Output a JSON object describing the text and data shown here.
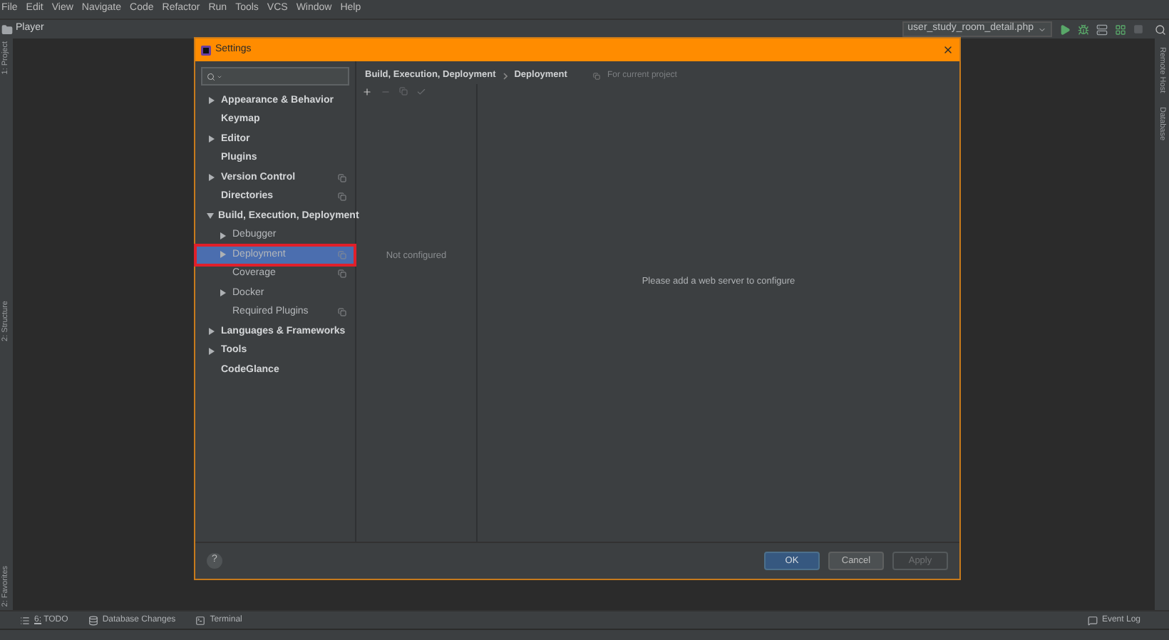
{
  "menu": [
    "File",
    "Edit",
    "View",
    "Navigate",
    "Code",
    "Refactor",
    "Run",
    "Tools",
    "VCS",
    "Window",
    "Help"
  ],
  "nav_bar": {
    "project": "Player",
    "run_config": "user_study_room_detail.php"
  },
  "left_strip": [
    "1: Project",
    "2: Structure",
    "2: Favorites"
  ],
  "right_strip": [
    "Remote Host",
    "Database"
  ],
  "dialog": {
    "title": "Settings",
    "tree": [
      {
        "label": "Appearance & Behavior",
        "kind": "group",
        "expanded": false,
        "selected": false,
        "highlighted": false,
        "project_scope": false
      },
      {
        "label": "Keymap",
        "kind": "leaf",
        "selected": false,
        "highlighted": false,
        "project_scope": false
      },
      {
        "label": "Editor",
        "kind": "group",
        "expanded": false,
        "selected": false,
        "highlighted": false,
        "project_scope": false
      },
      {
        "label": "Plugins",
        "kind": "leaf",
        "selected": false,
        "highlighted": false,
        "project_scope": false
      },
      {
        "label": "Version Control",
        "kind": "group",
        "expanded": false,
        "selected": false,
        "highlighted": false,
        "project_scope": true
      },
      {
        "label": "Directories",
        "kind": "leaf",
        "selected": false,
        "highlighted": false,
        "project_scope": true
      },
      {
        "label": "Build, Execution, Deployment",
        "kind": "group",
        "expanded": true,
        "selected": false,
        "highlighted": false,
        "project_scope": false,
        "children": [
          {
            "label": "Debugger",
            "kind": "group",
            "expanded": false,
            "selected": false,
            "highlighted": false,
            "project_scope": false
          },
          {
            "label": "Deployment",
            "kind": "group",
            "expanded": false,
            "selected": true,
            "highlighted": true,
            "project_scope": true
          },
          {
            "label": "Coverage",
            "kind": "leaf",
            "selected": false,
            "highlighted": false,
            "project_scope": true
          },
          {
            "label": "Docker",
            "kind": "group",
            "expanded": false,
            "selected": false,
            "highlighted": false,
            "project_scope": false
          },
          {
            "label": "Required Plugins",
            "kind": "leaf",
            "selected": false,
            "highlighted": false,
            "project_scope": true
          }
        ]
      },
      {
        "label": "Languages & Frameworks",
        "kind": "group",
        "expanded": false,
        "selected": false,
        "highlighted": false,
        "project_scope": false
      },
      {
        "label": "Tools",
        "kind": "group",
        "expanded": false,
        "selected": false,
        "highlighted": false,
        "project_scope": false
      },
      {
        "label": "CodeGlance",
        "kind": "leaf",
        "selected": false,
        "highlighted": false,
        "project_scope": false
      }
    ],
    "breadcrumb": [
      "Build, Execution, Deployment",
      "Deployment"
    ],
    "scope_note": "For current project",
    "list_empty": "Not configured",
    "detail_empty": "Please add a web server to configure",
    "help": "?",
    "buttons": [
      {
        "label": "OK",
        "kind": "primary",
        "disabled": false
      },
      {
        "label": "Cancel",
        "kind": "normal",
        "disabled": false
      },
      {
        "label": "Apply",
        "kind": "normal",
        "disabled": true
      }
    ]
  },
  "tool_windows": [
    {
      "number": "6:",
      "label": "TODO"
    },
    {
      "label": "Database Changes"
    },
    {
      "label": "Terminal"
    }
  ],
  "event_log": "Event Log"
}
